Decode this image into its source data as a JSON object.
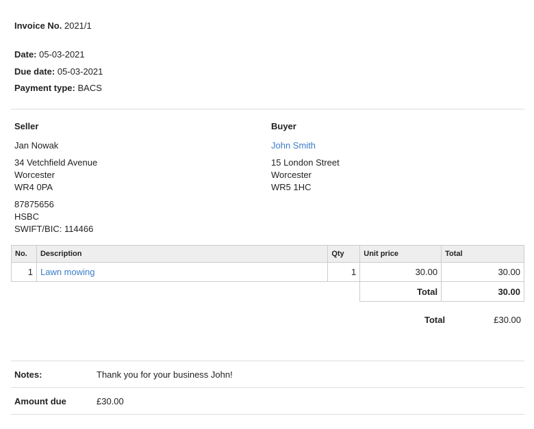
{
  "invoice": {
    "number_label": "Invoice No.",
    "number": "2021/1",
    "date_label": "Date:",
    "date": "05-03-2021",
    "due_label": "Due date:",
    "due": "05-03-2021",
    "payment_label": "Payment type:",
    "payment": "BACS"
  },
  "seller": {
    "heading": "Seller",
    "name": "Jan Nowak",
    "address": [
      "34 Vetchfield Avenue",
      "Worcester",
      "WR4 0PA"
    ],
    "bank": [
      "87875656",
      "HSBC",
      "SWIFT/BIC: 114466"
    ]
  },
  "buyer": {
    "heading": "Buyer",
    "name": "John Smith",
    "address": [
      "15 London Street",
      "Worcester",
      "WR5 1HC"
    ]
  },
  "items": {
    "headers": {
      "no": "No.",
      "description": "Description",
      "qty": "Qty",
      "unit_price": "Unit price",
      "total": "Total"
    },
    "rows": [
      {
        "no": "1",
        "description": "Lawn mowing",
        "qty": "1",
        "unit_price": "30.00",
        "total": "30.00"
      }
    ],
    "subtotal_label": "Total",
    "subtotal": "30.00"
  },
  "grand_total": {
    "label": "Total",
    "value": "£30.00"
  },
  "notes": {
    "label": "Notes:",
    "text": "Thank you for your business John!"
  },
  "amount_due": {
    "label": "Amount due",
    "value": "£30.00"
  }
}
